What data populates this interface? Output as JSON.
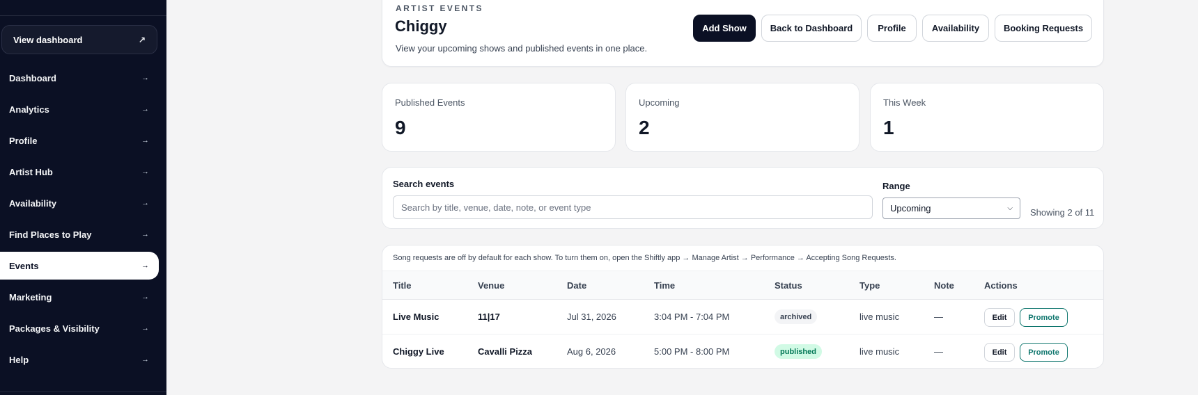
{
  "sidebar": {
    "view_dashboard": {
      "label": "View dashboard",
      "icon": "external-arrow-icon"
    },
    "items": [
      {
        "label": "Dashboard"
      },
      {
        "label": "Analytics"
      },
      {
        "label": "Profile"
      },
      {
        "label": "Artist Hub"
      },
      {
        "label": "Availability"
      },
      {
        "label": "Find Places to Play"
      },
      {
        "label": "Events",
        "active": true
      },
      {
        "label": "Marketing"
      },
      {
        "label": "Packages & Visibility"
      },
      {
        "label": "Help"
      }
    ],
    "chevron": "→"
  },
  "header": {
    "eyebrow": "ARTIST EVENTS",
    "title": "Chiggy",
    "subtitle": "View your upcoming shows and published events in one place.",
    "buttons": {
      "add_show": "Add Show",
      "back": "Back to Dashboard",
      "profile": "Profile",
      "availability": "Availability",
      "booking_requests": "Booking Requests"
    }
  },
  "stats": [
    {
      "label": "Published Events",
      "value": "9"
    },
    {
      "label": "Upcoming",
      "value": "2"
    },
    {
      "label": "This Week",
      "value": "1"
    }
  ],
  "filters": {
    "search_label": "Search events",
    "search_placeholder": "Search by title, venue, date, note, or event type",
    "range_label": "Range",
    "range_value": "Upcoming",
    "showing": "Showing 2 of 11"
  },
  "table": {
    "notice": "Song requests are off by default for each show. To turn them on, open the Shiftly app → Manage Artist → Performance → Accepting Song Requests.",
    "columns": [
      "Title",
      "Venue",
      "Date",
      "Time",
      "Status",
      "Type",
      "Note",
      "Actions"
    ],
    "rows": [
      {
        "title": "Live Music",
        "venue": "11|17",
        "date": "Jul 31, 2026",
        "time": "3:04 PM - 7:04 PM",
        "status": "archived",
        "type": "live music",
        "note": "—",
        "edit": "Edit",
        "promote": "Promote"
      },
      {
        "title": "Chiggy Live",
        "venue": "Cavalli Pizza",
        "date": "Aug 6, 2026",
        "time": "5:00 PM - 8:00 PM",
        "status": "published",
        "type": "live music",
        "note": "—",
        "edit": "Edit",
        "promote": "Promote"
      }
    ]
  },
  "colors": {
    "sidebar_bg": "#0b1024",
    "primary": "#0b1024",
    "promote": "#0f766e",
    "published_badge": "#d1fae5"
  }
}
